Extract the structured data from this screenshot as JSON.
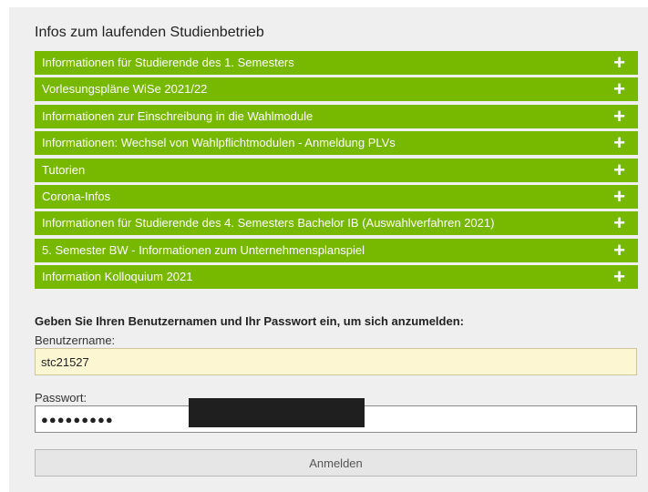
{
  "section": {
    "title": "Infos zum laufenden Studienbetrieb",
    "accent_color": "#77b800",
    "expand_icon": "plus-icon",
    "items": [
      {
        "label": "Informationen für Studierende des 1. Semesters"
      },
      {
        "label": "Vorlesungspläne WiSe 2021/22"
      },
      {
        "label": "Informationen zur Einschreibung in die Wahlmodule"
      },
      {
        "label": "Informationen: Wechsel von Wahlpflichtmodulen - Anmeldung PLVs"
      },
      {
        "label": "Tutorien"
      },
      {
        "label": "Corona-Infos"
      },
      {
        "label": "Informationen für Studierende des 4. Semesters Bachelor IB (Auswahlverfahren 2021)"
      },
      {
        "label": "5. Semester BW - Informationen zum Unternehmensplanspiel"
      },
      {
        "label": "Information Kolloquium 2021"
      }
    ]
  },
  "login": {
    "prompt": "Geben Sie Ihren Benutzernamen und Ihr Passwort ein, um sich anzumelden:",
    "username_label": "Benutzername:",
    "username_value": "stc21527",
    "password_label": "Passwort:",
    "password_value": "●●●●●●●●●",
    "submit_label": "Anmelden"
  }
}
